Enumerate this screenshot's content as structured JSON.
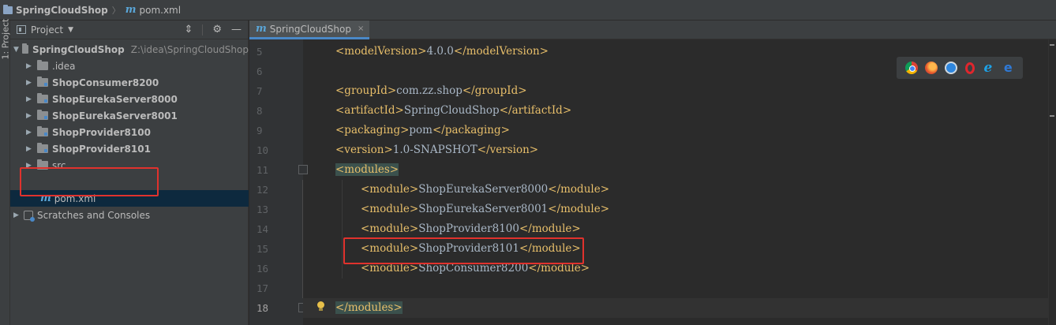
{
  "navbar": {
    "project": "SpringCloudShop",
    "separator": "〉",
    "file_icon": "m",
    "file": "pom.xml"
  },
  "tool_strip": {
    "label": "1: Project"
  },
  "project_panel": {
    "title": "Project",
    "tool_icons": [
      "collapse-icon",
      "gear-icon",
      "minimize-icon"
    ],
    "root": {
      "name": "SpringCloudShop",
      "path": "Z:\\idea\\SpringCloudShop"
    },
    "items": [
      {
        "label": ".idea",
        "bold": false
      },
      {
        "label": "ShopConsumer8200",
        "bold": true
      },
      {
        "label": "ShopEurekaServer8000",
        "bold": true
      },
      {
        "label": "ShopEurekaServer8001",
        "bold": true
      },
      {
        "label": "ShopProvider8100",
        "bold": true
      },
      {
        "label": "ShopProvider8101",
        "bold": true
      },
      {
        "label": "src",
        "bold": false
      }
    ],
    "selected_file": "pom.xml",
    "scratches": "Scratches and Consoles"
  },
  "editor": {
    "tab": {
      "icon": "m",
      "label": "SpringCloudShop",
      "close": "×"
    },
    "lines": [
      {
        "num": "5",
        "indent": 1,
        "parts": [
          {
            "t": "tag",
            "v": "<modelVersion>"
          },
          {
            "t": "txt",
            "v": "4.0.0"
          },
          {
            "t": "tag",
            "v": "</modelVersion>"
          }
        ]
      },
      {
        "num": "6",
        "indent": 0,
        "parts": []
      },
      {
        "num": "7",
        "indent": 1,
        "parts": [
          {
            "t": "tag",
            "v": "<groupId>"
          },
          {
            "t": "txt",
            "v": "com.zz.shop"
          },
          {
            "t": "tag",
            "v": "</groupId>"
          }
        ]
      },
      {
        "num": "8",
        "indent": 1,
        "parts": [
          {
            "t": "tag",
            "v": "<artifactId>"
          },
          {
            "t": "txt",
            "v": "SpringCloudShop"
          },
          {
            "t": "tag",
            "v": "</artifactId>"
          }
        ]
      },
      {
        "num": "9",
        "indent": 1,
        "parts": [
          {
            "t": "tag",
            "v": "<packaging>"
          },
          {
            "t": "txt",
            "v": "pom"
          },
          {
            "t": "tag",
            "v": "</packaging>"
          }
        ]
      },
      {
        "num": "10",
        "indent": 1,
        "parts": [
          {
            "t": "tag",
            "v": "<version>"
          },
          {
            "t": "txt",
            "v": "1.0-SNAPSHOT"
          },
          {
            "t": "tag",
            "v": "</version>"
          }
        ]
      },
      {
        "num": "11",
        "indent": 1,
        "parts": [
          {
            "t": "tag hl",
            "v": "<modules>"
          }
        ]
      },
      {
        "num": "12",
        "indent": 2,
        "parts": [
          {
            "t": "tag",
            "v": "<module>"
          },
          {
            "t": "txt",
            "v": "ShopEurekaServer8000"
          },
          {
            "t": "tag",
            "v": "</module>"
          }
        ]
      },
      {
        "num": "13",
        "indent": 2,
        "parts": [
          {
            "t": "tag",
            "v": "<module>"
          },
          {
            "t": "txt",
            "v": "ShopEurekaServer8001"
          },
          {
            "t": "tag",
            "v": "</module>"
          }
        ]
      },
      {
        "num": "14",
        "indent": 2,
        "parts": [
          {
            "t": "tag",
            "v": "<module>"
          },
          {
            "t": "txt",
            "v": "ShopProvider8100"
          },
          {
            "t": "tag",
            "v": "</module>"
          }
        ]
      },
      {
        "num": "15",
        "indent": 2,
        "parts": [
          {
            "t": "tag",
            "v": "<module>"
          },
          {
            "t": "txt",
            "v": "ShopProvider8101"
          },
          {
            "t": "tag",
            "v": "</module>"
          }
        ]
      },
      {
        "num": "16",
        "indent": 2,
        "parts": [
          {
            "t": "tag",
            "v": "<module>"
          },
          {
            "t": "txt",
            "v": "ShopConsumer8200"
          },
          {
            "t": "tag",
            "v": "</module>"
          }
        ]
      },
      {
        "num": "17",
        "indent": 0,
        "parts": []
      },
      {
        "num": "18",
        "indent": 1,
        "parts": [
          {
            "t": "tag hl",
            "v": "</modules>"
          }
        ]
      }
    ],
    "current_line": "18",
    "browser_icons": [
      "chrome-icon",
      "firefox-icon",
      "safari-icon",
      "opera-icon",
      "internet-explorer-icon",
      "edge-icon"
    ]
  },
  "colors": {
    "tag": "#e8bf6a",
    "text": "#a9b7c6",
    "highlight_box": "#e0322d",
    "selection": "#0d293e"
  }
}
